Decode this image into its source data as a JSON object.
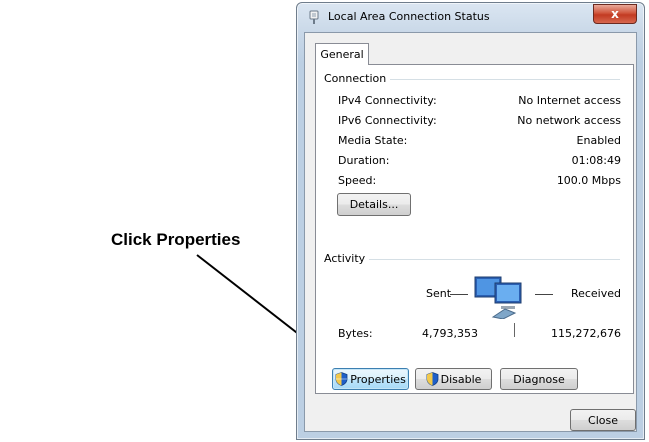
{
  "annotation": {
    "text": "Click Properties"
  },
  "window": {
    "title": "Local Area Connection Status",
    "close_glyph": "x",
    "tab": "General",
    "connection": {
      "label": "Connection",
      "rows": [
        {
          "key": "IPv4 Connectivity:",
          "value": "No Internet access"
        },
        {
          "key": "IPv6 Connectivity:",
          "value": "No network access"
        },
        {
          "key": "Media State:",
          "value": "Enabled"
        },
        {
          "key": "Duration:",
          "value": "01:08:49"
        },
        {
          "key": "Speed:",
          "value": "100.0 Mbps"
        }
      ],
      "details_button": "Details..."
    },
    "activity": {
      "label": "Activity",
      "sent_label": "Sent",
      "received_label": "Received",
      "bytes_label": "Bytes:",
      "bytes_sent": "4,793,353",
      "bytes_received": "115,272,676"
    },
    "buttons": {
      "properties": "Properties",
      "disable": "Disable",
      "diagnose": "Diagnose",
      "close": "Close"
    },
    "icons": {
      "title": "network-adapter-icon",
      "activity": "network-computers-icon",
      "shield": "uac-shield-icon"
    }
  }
}
